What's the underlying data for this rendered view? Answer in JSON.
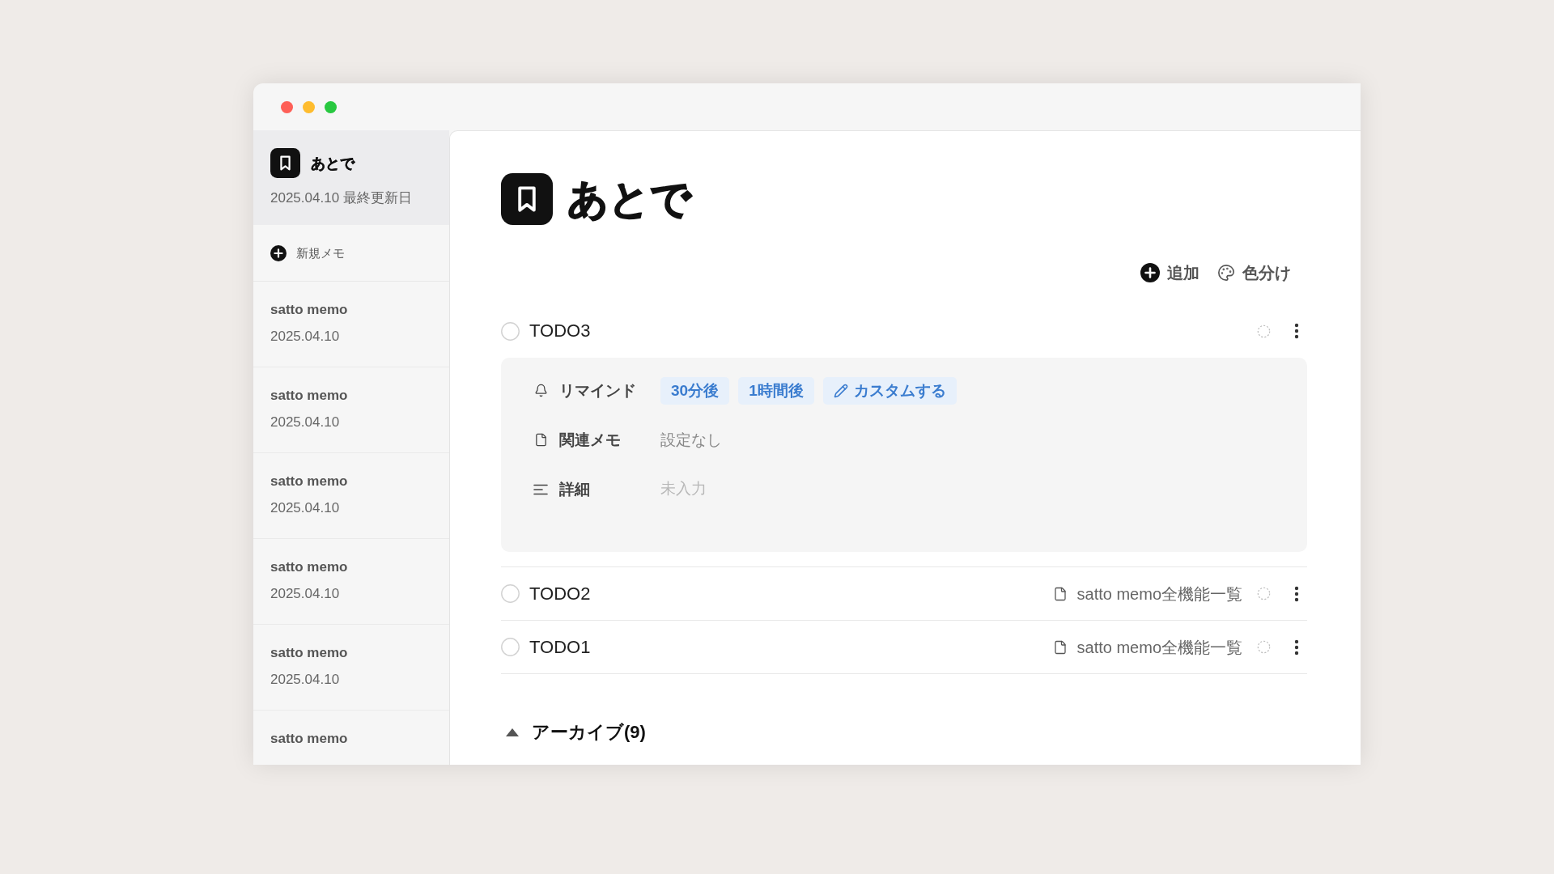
{
  "sidebar": {
    "current_page": {
      "title": "あとで",
      "updated": "2025.04.10 最終更新日"
    },
    "new_memo": {
      "label": "新規メモ"
    },
    "memos": [
      {
        "title": "satto memo",
        "date": "2025.04.10"
      },
      {
        "title": "satto memo",
        "date": "2025.04.10"
      },
      {
        "title": "satto memo",
        "date": "2025.04.10"
      },
      {
        "title": "satto memo",
        "date": "2025.04.10"
      },
      {
        "title": "satto memo",
        "date": "2025.04.10"
      },
      {
        "title": "satto memo"
      }
    ]
  },
  "page": {
    "title": "あとで",
    "toolbar": [
      {
        "kind": "add",
        "label": "追加"
      },
      {
        "kind": "color",
        "label": "色分け"
      }
    ],
    "todos": [
      {
        "title": "TODO3",
        "checked": false,
        "expanded": true,
        "details": [
          {
            "kind": "reminder",
            "label": "リマインド",
            "options": [
              {
                "kind": "preset",
                "label": "30分後"
              },
              {
                "kind": "preset",
                "label": "1時間後"
              },
              {
                "kind": "custom",
                "label": "カスタムする"
              }
            ]
          },
          {
            "kind": "related_memo",
            "label": "関連メモ",
            "value": "設定なし"
          },
          {
            "kind": "detail",
            "label": "詳細",
            "placeholder": "未入力"
          }
        ]
      },
      {
        "title": "TODO2",
        "checked": false,
        "expanded": false,
        "linked_memo": "satto memo全機能一覧"
      },
      {
        "title": "TODO1",
        "checked": false,
        "expanded": false,
        "linked_memo": "satto memo全機能一覧"
      }
    ],
    "archive": {
      "label": "アーカイブ(9)",
      "expanded": true
    }
  }
}
